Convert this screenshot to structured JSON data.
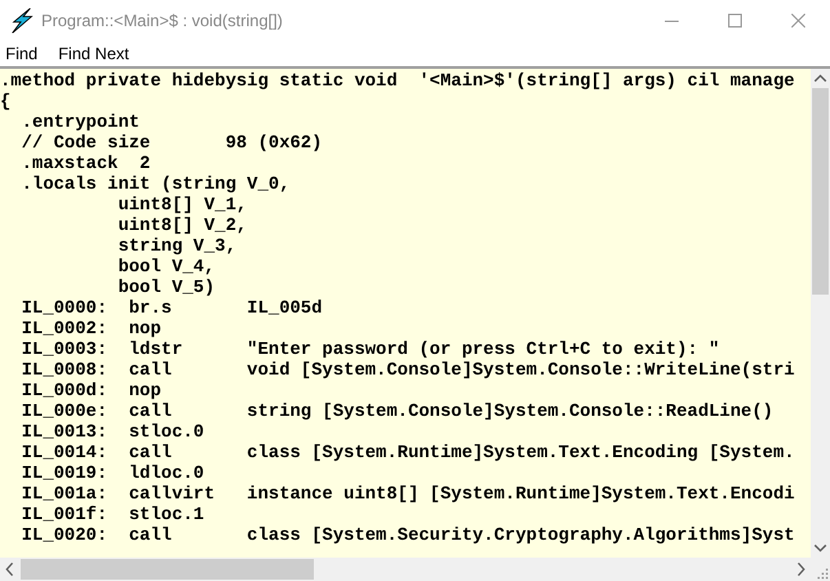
{
  "window": {
    "title": "Program::<Main>$ : void(string[])"
  },
  "menu": [
    "Find",
    "Find Next"
  ],
  "code_lines": [
    ".method private hidebysig static void  '<Main>$'(string[] args) cil manage",
    "{",
    "  .entrypoint",
    "  // Code size       98 (0x62)",
    "  .maxstack  2",
    "  .locals init (string V_0,",
    "           uint8[] V_1,",
    "           uint8[] V_2,",
    "           string V_3,",
    "           bool V_4,",
    "           bool V_5)",
    "  IL_0000:  br.s       IL_005d",
    "  IL_0002:  nop",
    "  IL_0003:  ldstr      \"Enter password (or press Ctrl+C to exit): \"",
    "  IL_0008:  call       void [System.Console]System.Console::WriteLine(stri",
    "  IL_000d:  nop",
    "  IL_000e:  call       string [System.Console]System.Console::ReadLine()",
    "  IL_0013:  stloc.0",
    "  IL_0014:  call       class [System.Runtime]System.Text.Encoding [System.",
    "  IL_0019:  ldloc.0",
    "  IL_001a:  callvirt   instance uint8[] [System.Runtime]System.Text.Encodi",
    "  IL_001f:  stloc.1",
    "  IL_0020:  call       class [System.Security.Cryptography.Algorithms]Syst"
  ]
}
